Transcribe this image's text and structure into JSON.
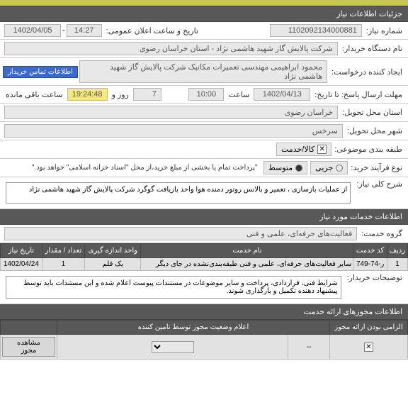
{
  "header_title": "جزئیات اطلاعات نیاز",
  "f": {
    "req_no_lbl": "شماره نیاز:",
    "req_no": "1102092134000881",
    "announce_lbl": "تاریخ و ساعت اعلان عمومی:",
    "announce_date": "1402/04/05",
    "announce_time": "14:27",
    "buyer_lbl": "نام دستگاه خریدار:",
    "buyer": "شرکت پالایش گاز شهید هاشمی نژاد - استان خراسان رضوی",
    "creator_lbl": "ایجاد کننده درخواست:",
    "creator": "محمود ابراهیمی مهندسی تعمیرات مکانیک شرکت پالایش گاز شهید هاشمی نژاد",
    "contact_btn": "اطلاعات تماس خریدار",
    "deadline_lbl": "مهلت ارسال پاسخ: تا تاریخ:",
    "deadline_date": "1402/04/13",
    "at_lbl": "ساعت",
    "deadline_time": "10:00",
    "days_lbl": "روز و",
    "days": "7",
    "remain_time": "19:24:48",
    "remain_lbl": "ساعت باقی مانده",
    "prov_lbl": "استان محل تحویل:",
    "prov": "خراسان رضوی",
    "city_lbl": "شهر محل تحویل:",
    "city": "سرخس",
    "cat_lbl": "طبقه بندی موضوعی:",
    "cat_goods": "کالا/خدمت",
    "buytype_lbl": "نوع فرآیند خرید:",
    "buytype_low": "جزیی",
    "buytype_mid": "متوسط",
    "buytype_note": "\"پرداخت تمام یا بخشی از مبلغ خرید،از محل \"اسناد خزانه اسلامی\" خواهد بود.\"",
    "desc_lbl": "شرح کلی نیاز:",
    "desc": "از عملیات بازسازی ، تعمیر و بالانس روتور دمنده هوا واحد بازیافت گوگرد شرکت پالایش گاز شهید هاشمی نژاد",
    "svc_info_title": "اطلاعات خدمات مورد نیاز",
    "svc_group_lbl": "گروه خدمت:",
    "svc_group": "فعالیت‌های حرفه‌ای، علمی و فنی",
    "th_row": "ردیف",
    "th_code": "کد خدمت",
    "th_name": "نام خدمت",
    "th_unit": "واحد اندازه گیری",
    "th_qty": "تعداد / مقدار",
    "th_date": "تاریخ نیاز",
    "row_idx": "1",
    "row_code": "ر-74-749",
    "row_name": "سایر فعالیت‌های حرفه‌ای، علمی و فنی طبقه‌بندی‌نشده در جای دیگر",
    "row_unit": "یک قلم",
    "row_qty": "1",
    "row_date": "1402/04/24",
    "buyer_notes_lbl": "توضیحات خریدار:",
    "buyer_notes": "شرایط فنی، قراردادی، پرداخت و سایر موضوعات در مستندات پیوست اعلام شده و این مستندات باید توسط پیشنهاد دهنده تکمیل و بارگذاری شوند.",
    "lic_info_title": "اطلاعات مجوزهای ارائه خدمت",
    "th_lic_req": "الزامی بودن ارائه مجوز",
    "th_lic_status": "اعلام وضعیت مجوز توسط تامین کننده",
    "view_lic_btn": "مشاهده مجوز",
    "dash": "--"
  }
}
